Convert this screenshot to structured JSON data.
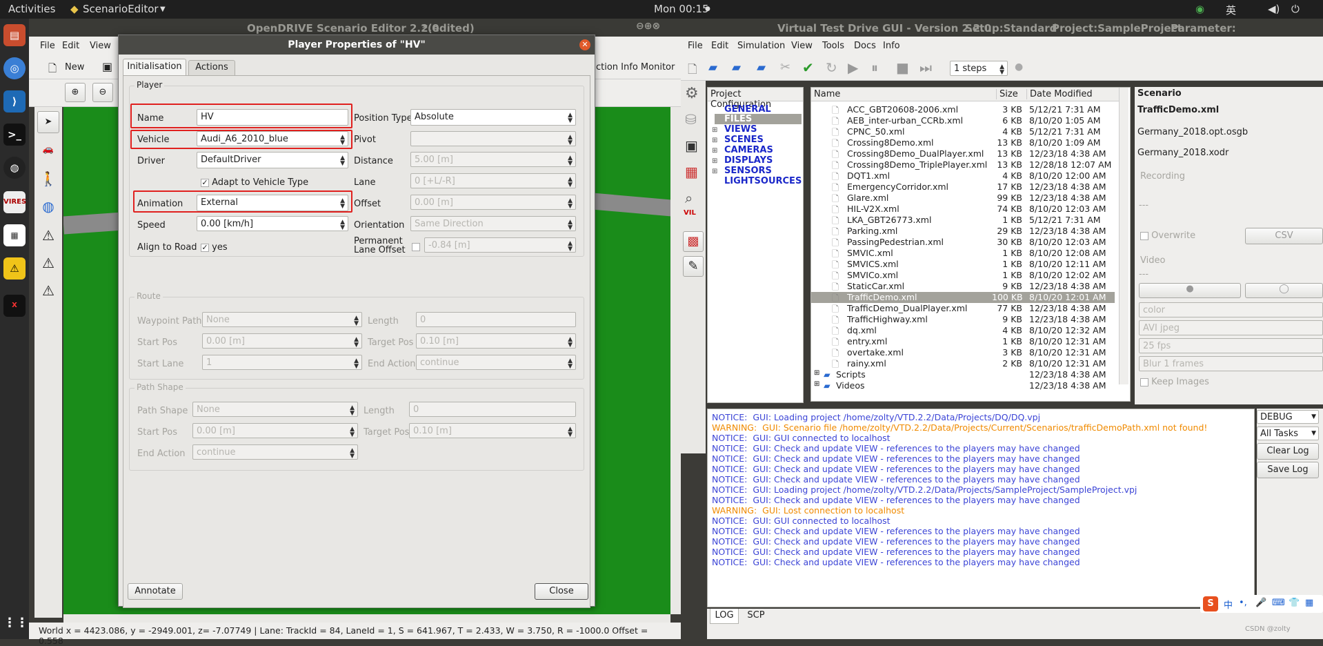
{
  "topbar": {
    "activities": "Activities",
    "app": "ScenarioEditor",
    "clock": "Mon 00:15",
    "lang": "英"
  },
  "editor": {
    "title": "OpenDRIVE Scenario Editor 2.2.0",
    "edited": "*(edited)",
    "menu": [
      "File",
      "Edit",
      "View"
    ],
    "new_label": "New",
    "partial_tab": "ction Info Monitor",
    "status": "World x = 4423.086, y = -2949.001, z= -7.07749 | Lane: TrackId = 84, LaneId = 1, S = 641.967, T = 2.433, W = 3.750, R = -1000.0 Offset = 0.558"
  },
  "dialog": {
    "title": "Player Properties of \"HV\"",
    "tabs": [
      "Initialisation",
      "Actions"
    ],
    "player_group": "Player",
    "name_label": "Name",
    "name_value": "HV",
    "vehicle_label": "Vehicle",
    "vehicle_value": "Audi_A6_2010_blue",
    "driver_label": "Driver",
    "driver_value": "DefaultDriver",
    "adapt_label": "Adapt to Vehicle Type",
    "animation_label": "Animation",
    "animation_value": "External",
    "speed_label": "Speed",
    "speed_value": "0.00 [km/h]",
    "align_label": "Align to Road",
    "align_value": "yes",
    "postype_label": "Position Type",
    "postype_value": "Absolute",
    "pivot_label": "Pivot",
    "pivot_value": "",
    "distance_label": "Distance",
    "distance_value": "5.00 [m]",
    "lane_label": "Lane",
    "lane_value": "0 [+L/-R]",
    "offset_label": "Offset",
    "offset_value": "0.00 [m]",
    "orientation_label": "Orientation",
    "orientation_value": "Same Direction",
    "perm_label": "Permanent",
    "perm_label2": "Lane Offset",
    "perm_value": "-0.84 [m]",
    "route_group": "Route",
    "waypoint_label": "Waypoint Path",
    "waypoint_value": "None",
    "length_label": "Length",
    "length_value": "0",
    "startpos_label": "Start Pos",
    "startpos_value": "0.00 [m]",
    "targetpos_label": "Target Pos",
    "targetpos_value": "0.10 [m]",
    "startlane_label": "Start Lane",
    "startlane_value": "1",
    "endaction_label": "End Action",
    "endaction_value": "continue",
    "pathshape_group": "Path Shape",
    "ps_label": "Path Shape",
    "ps_value": "None",
    "ps_length_label": "Length",
    "ps_length_value": "0",
    "ps_start_label": "Start Pos",
    "ps_start_value": "0.00 [m]",
    "ps_target_label": "Target Pos",
    "ps_target_value": "0.10 [m]",
    "ps_end_label": "End Action",
    "ps_end_value": "continue",
    "annotate": "Annotate",
    "close": "Close"
  },
  "vtd": {
    "title": "Virtual Test Drive GUI - Version 2.2.0",
    "setup": "Setup:Standard",
    "project": "Project:SampleProject",
    "param": "Parameter:",
    "menu": [
      "File",
      "Edit",
      "Simulation",
      "View",
      "Tools",
      "Docs",
      "Info"
    ],
    "steps": "1 steps",
    "projcfg_header": "Project Configuration",
    "tree": [
      "GENERAL",
      "FILES",
      "VIEWS",
      "SCENES",
      "CAMERAS",
      "DISPLAYS",
      "SENSORS",
      "LIGHTSOURCES"
    ],
    "cols": [
      "Name",
      "Size",
      "Date Modified"
    ],
    "files": [
      [
        "ACC_GBT20608-2006.xml",
        "3 KB",
        "5/12/21 7:31 AM"
      ],
      [
        "AEB_inter-urban_CCRb.xml",
        "6 KB",
        "8/10/20 1:05 AM"
      ],
      [
        "CPNC_50.xml",
        "4 KB",
        "5/12/21 7:31 AM"
      ],
      [
        "Crossing8Demo.xml",
        "13 KB",
        "8/10/20 1:09 AM"
      ],
      [
        "Crossing8Demo_DualPlayer.xml",
        "13 KB",
        "12/23/18 4:38 AM"
      ],
      [
        "Crossing8Demo_TriplePlayer.xml",
        "13 KB",
        "12/28/18 12:07 AM"
      ],
      [
        "DQT1.xml",
        "4 KB",
        "8/10/20 12:00 AM"
      ],
      [
        "EmergencyCorridor.xml",
        "17 KB",
        "12/23/18 4:38 AM"
      ],
      [
        "Glare.xml",
        "99 KB",
        "12/23/18 4:38 AM"
      ],
      [
        "HIL-V2X.xml",
        "74 KB",
        "8/10/20 12:03 AM"
      ],
      [
        "LKA_GBT26773.xml",
        "1 KB",
        "5/12/21 7:31 AM"
      ],
      [
        "Parking.xml",
        "29 KB",
        "12/23/18 4:38 AM"
      ],
      [
        "PassingPedestrian.xml",
        "30 KB",
        "8/10/20 12:03 AM"
      ],
      [
        "SMVIC.xml",
        "1 KB",
        "8/10/20 12:08 AM"
      ],
      [
        "SMVICS.xml",
        "1 KB",
        "8/10/20 12:11 AM"
      ],
      [
        "SMVICo.xml",
        "1 KB",
        "8/10/20 12:02 AM"
      ],
      [
        "StaticCar.xml",
        "9 KB",
        "12/23/18 4:38 AM"
      ],
      [
        "TrafficDemo.xml",
        "100 KB",
        "8/10/20 12:01 AM"
      ],
      [
        "TrafficDemo_DualPlayer.xml",
        "77 KB",
        "12/23/18 4:38 AM"
      ],
      [
        "TrafficHighway.xml",
        "9 KB",
        "12/23/18 4:38 AM"
      ],
      [
        "dq.xml",
        "4 KB",
        "8/10/20 12:32 AM"
      ],
      [
        "entry.xml",
        "1 KB",
        "8/10/20 12:31 AM"
      ],
      [
        "overtake.xml",
        "3 KB",
        "8/10/20 12:31 AM"
      ],
      [
        "rainy.xml",
        "2 KB",
        "8/10/20 12:31 AM"
      ]
    ],
    "scripts": [
      "Scripts",
      "12/23/18 4:38 AM"
    ],
    "videos": [
      "Videos",
      "12/23/18 4:38 AM"
    ],
    "scenario_header": "Scenario",
    "scenario_file": "TrafficDemo.xml",
    "osgb": "Germany_2018.opt.osgb",
    "xodr": "Germany_2018.xodr",
    "recording": "Recording",
    "rec_dash": "---",
    "overwrite": "Overwrite",
    "csv": "CSV",
    "video": "Video",
    "vid_dash": "---",
    "color": "color",
    "avi": "AVI jpeg",
    "fps": "25 fps",
    "blur": "Blur 1 frames",
    "keep": "Keep Images",
    "debug": "DEBUG",
    "alltasks": "All Tasks",
    "clearlog": "Clear Log",
    "savelog": "Save Log",
    "tabs": [
      "LOG",
      "SCP"
    ],
    "watermark": "CSDN @zolty",
    "log": [
      [
        "NOTICE:",
        "GUI: Loading project /home/zolty/VTD.2.2/Data/Projects/DQ/DQ.vpj"
      ],
      [
        "WARNING:",
        "GUI: Scenario file /home/zolty/VTD.2.2/Data/Projects/Current/Scenarios/trafficDemoPath.xml not found!"
      ],
      [
        "NOTICE:",
        "GUI: GUI connected to localhost"
      ],
      [
        "NOTICE:",
        "GUI: Check and update VIEW - references to the players may have changed"
      ],
      [
        "NOTICE:",
        "GUI: Check and update VIEW - references to the players may have changed"
      ],
      [
        "NOTICE:",
        "GUI: Check and update VIEW - references to the players may have changed"
      ],
      [
        "NOTICE:",
        "GUI: Check and update VIEW - references to the players may have changed"
      ],
      [
        "NOTICE:",
        "GUI: Loading project /home/zolty/VTD.2.2/Data/Projects/SampleProject/SampleProject.vpj"
      ],
      [
        "NOTICE:",
        "GUI: Check and update VIEW - references to the players may have changed"
      ],
      [
        "WARNING:",
        "GUI: Lost connection to localhost"
      ],
      [
        "NOTICE:",
        "GUI: GUI connected to localhost"
      ],
      [
        "NOTICE:",
        "GUI: Check and update VIEW - references to the players may have changed"
      ],
      [
        "NOTICE:",
        "GUI: Check and update VIEW - references to the players may have changed"
      ],
      [
        "NOTICE:",
        "GUI: Check and update VIEW - references to the players may have changed"
      ],
      [
        "NOTICE:",
        "GUI: Check and update VIEW - references to the players may have changed"
      ]
    ],
    "notice_color": "#3b44d6",
    "warning_color": "#f08a00"
  },
  "ime": {
    "chars": [
      "中"
    ]
  }
}
